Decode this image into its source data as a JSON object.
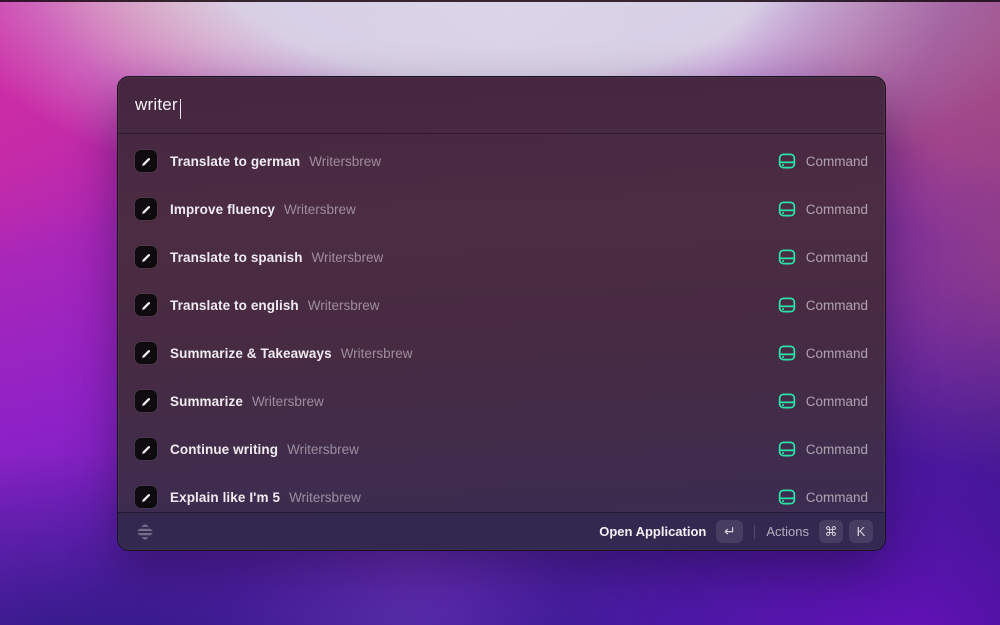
{
  "window": {
    "search": {
      "value": "writer"
    },
    "results": {
      "items": [
        {
          "title": "Translate to german",
          "subtitle": "Writersbrew",
          "accessory": "Command"
        },
        {
          "title": "Improve fluency",
          "subtitle": "Writersbrew",
          "accessory": "Command"
        },
        {
          "title": "Translate to spanish",
          "subtitle": "Writersbrew",
          "accessory": "Command"
        },
        {
          "title": "Translate to english",
          "subtitle": "Writersbrew",
          "accessory": "Command"
        },
        {
          "title": "Summarize & Takeaways",
          "subtitle": "Writersbrew",
          "accessory": "Command"
        },
        {
          "title": "Summarize",
          "subtitle": "Writersbrew",
          "accessory": "Command"
        },
        {
          "title": "Continue writing",
          "subtitle": "Writersbrew",
          "accessory": "Command"
        },
        {
          "title": "Explain like I'm 5",
          "subtitle": "Writersbrew",
          "accessory": "Command"
        }
      ],
      "item_icon": "pencil-icon",
      "accessory_icon": "command-icon"
    },
    "footer": {
      "logo_icon": "raycast-logo-icon",
      "primary_action": {
        "label": "Open Application",
        "key": "↵"
      },
      "secondary_action": {
        "label": "Actions",
        "keys": [
          "⌘",
          "K"
        ]
      }
    }
  },
  "colors": {
    "accent_green": "#2be3a9",
    "window_background_top": "#452640",
    "window_background_bottom": "#3a2d55",
    "row_icon_background": "#0d0b0e",
    "wallpaper_magenta": "#d12aa3",
    "wallpaper_lavender": "#d8cfe5",
    "wallpaper_violet": "#9013e9",
    "wallpaper_indigo": "#2c1a80"
  }
}
